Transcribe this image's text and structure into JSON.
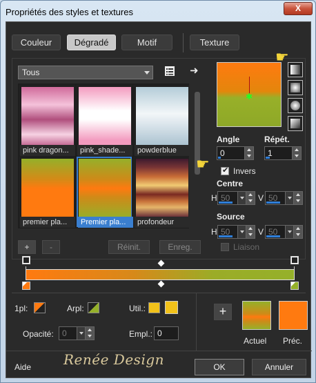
{
  "window": {
    "title": "Propriétés des styles et textures",
    "close_label": "X"
  },
  "tabs": [
    {
      "label": "Couleur",
      "active": false
    },
    {
      "label": "Dégradé",
      "active": true
    },
    {
      "label": "Motif",
      "active": false
    },
    {
      "label": "Texture",
      "active": false
    }
  ],
  "gallery": {
    "category_selected": "Tous",
    "items": [
      {
        "label": "pink dragon..."
      },
      {
        "label": "pink_shade..."
      },
      {
        "label": "powderblue"
      },
      {
        "label": "premier pla..."
      },
      {
        "label": "Premier pla...",
        "selected": true
      },
      {
        "label": "profondeur"
      }
    ]
  },
  "gallery_buttons": {
    "add": "+",
    "remove": "-",
    "reset": "Réinit.",
    "save": "Enreg."
  },
  "settings": {
    "angle_label": "Angle",
    "angle_value": "0",
    "repeat_label": "Répét.",
    "repeat_value": "1",
    "invert_label": "Invers",
    "invert_checked": true,
    "center_label": "Centre",
    "center_h_label": "H",
    "center_h": "50",
    "center_v_label": "V",
    "center_v": "50",
    "source_label": "Source",
    "source_h_label": "H",
    "source_h": "50",
    "source_v_label": "V",
    "source_v": "50",
    "link_label": "Liaison",
    "link_checked": false
  },
  "stops": {
    "first_label": "1pl:",
    "bg_label": "Arpl:",
    "user_label": "Util.:",
    "opacity_label": "Opacité:",
    "opacity_value": "0",
    "location_label": "Empl.:",
    "location_value": "0"
  },
  "preview_swatches": {
    "current_label": "Actuel",
    "previous_label": "Préc."
  },
  "footer": {
    "help": "Aide",
    "ok": "OK",
    "cancel": "Annuler",
    "watermark": "Renée Design"
  },
  "colors": {
    "orange": "#ff7a10",
    "olive": "#95b02a",
    "selected_blue": "#3a7fd0",
    "yellow": "#f2c21a"
  }
}
